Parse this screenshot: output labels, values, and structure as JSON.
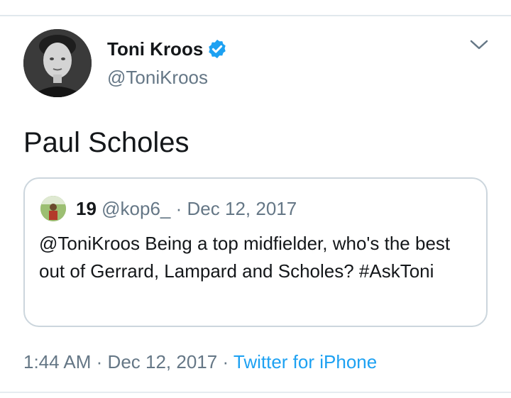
{
  "tweet": {
    "author": {
      "name": "Toni Kroos",
      "handle": "@ToniKroos"
    },
    "text": "Paul Scholes",
    "quoted": {
      "name": "19",
      "handle": "@kop6_",
      "separator": "·",
      "date": "Dec 12, 2017",
      "body": "@ToniKroos Being a top midfielder, who's the best out of Gerrard, Lampard and Scholes? #AskToni"
    },
    "footer": {
      "time": "1:44 AM",
      "dot1": "·",
      "date": "Dec 12, 2017",
      "dot2": "·",
      "source": "Twitter for iPhone"
    }
  },
  "icons": {
    "verified": "verified-badge-icon",
    "menu": "chevron-down-icon"
  },
  "colors": {
    "accent": "#1da1f2",
    "secondary_text": "#657786",
    "border": "#ccd6dd"
  }
}
